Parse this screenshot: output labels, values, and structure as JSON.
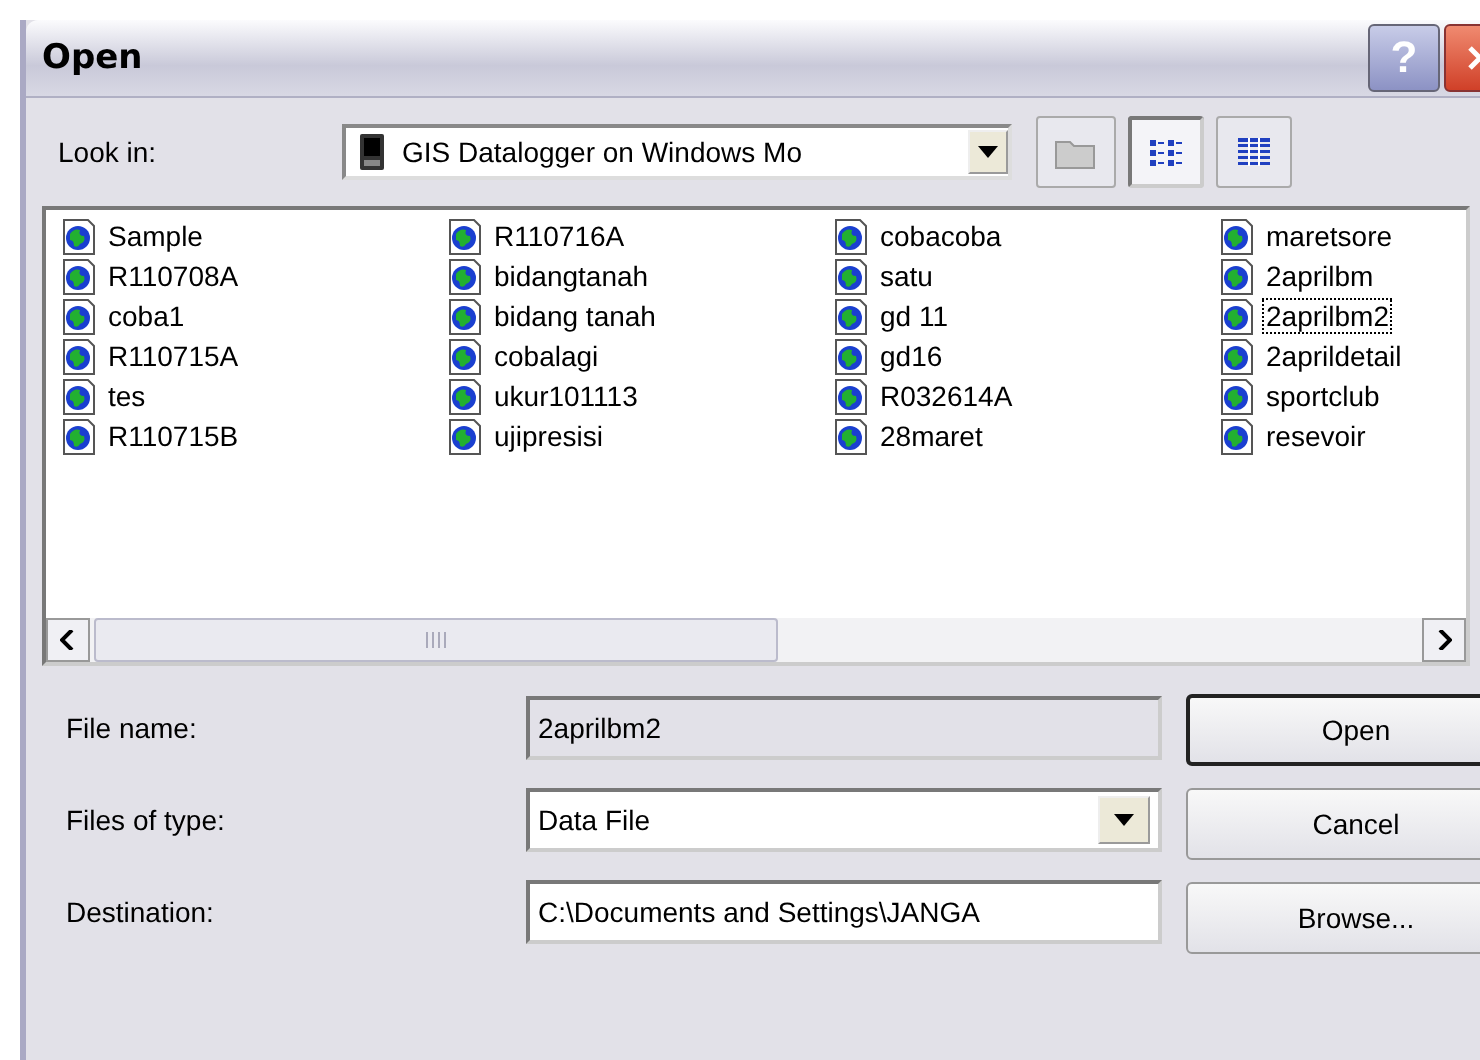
{
  "window": {
    "title": "Open",
    "help_button": "?"
  },
  "look_in": {
    "label": "Look in:",
    "value": "GIS Datalogger on Windows Mo"
  },
  "toolbar": [
    {
      "kind": "up-folder",
      "disabled": true
    },
    {
      "kind": "list-view",
      "selected": true
    },
    {
      "kind": "details-view",
      "selected": false
    }
  ],
  "files": [
    {
      "name": "Sample",
      "focused": false
    },
    {
      "name": "R110708A",
      "focused": false
    },
    {
      "name": "coba1",
      "focused": false
    },
    {
      "name": "R110715A",
      "focused": false
    },
    {
      "name": "tes",
      "focused": false
    },
    {
      "name": "R110715B",
      "focused": false
    },
    {
      "name": "R110716A",
      "focused": false
    },
    {
      "name": "bidangtanah",
      "focused": false
    },
    {
      "name": "bidang tanah",
      "focused": false
    },
    {
      "name": "cobalagi",
      "focused": false
    },
    {
      "name": "ukur101113",
      "focused": false
    },
    {
      "name": "ujipresisi",
      "focused": false
    },
    {
      "name": "cobacoba",
      "focused": false
    },
    {
      "name": "satu",
      "focused": false
    },
    {
      "name": "gd 11",
      "focused": false
    },
    {
      "name": "gd16",
      "focused": false
    },
    {
      "name": "R032614A",
      "focused": false
    },
    {
      "name": "28maret",
      "focused": false
    },
    {
      "name": "maretsore",
      "focused": false
    },
    {
      "name": "2aprilbm",
      "focused": false
    },
    {
      "name": "2aprilbm2",
      "focused": true
    },
    {
      "name": "2aprildetail",
      "focused": false
    },
    {
      "name": "sportclub",
      "focused": false
    },
    {
      "name": "resevoir",
      "focused": false
    }
  ],
  "fields": [
    {
      "kind": "text",
      "label": "File name:",
      "value": "2aprilbm2",
      "disabled": true
    },
    {
      "kind": "dropdown",
      "label": "Files of type:",
      "value": "Data File",
      "disabled": false
    },
    {
      "kind": "text",
      "label": "Destination:",
      "value": "C:\\Documents and Settings\\JANGA",
      "disabled": false
    }
  ],
  "buttons": [
    {
      "label": "Open",
      "default": true
    },
    {
      "label": "Cancel",
      "default": false
    },
    {
      "label": "Browse...",
      "default": false
    }
  ]
}
